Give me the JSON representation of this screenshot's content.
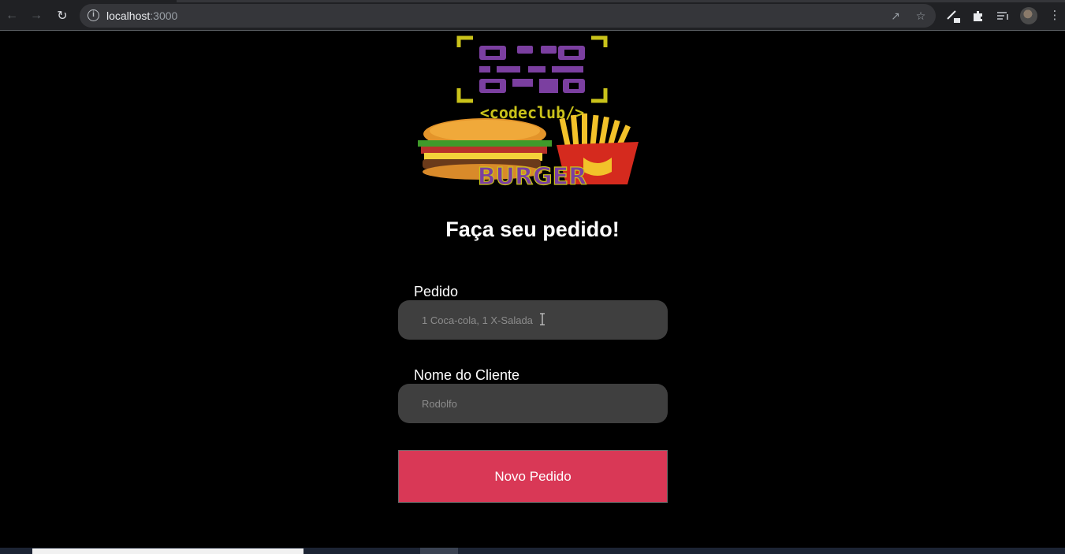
{
  "browser": {
    "url_host": "localhost",
    "url_port": ":3000",
    "icons": [
      "back-arrow-icon",
      "forward-arrow-icon",
      "reload-icon",
      "info-icon",
      "share-icon",
      "star-icon",
      "edit-icon",
      "extensions-icon",
      "reading-list-icon",
      "profile-avatar",
      "more-icon"
    ]
  },
  "page": {
    "logo_text": "<codeclub/>",
    "logo_sub": "BURGER",
    "heading": "Faça seu pedido!",
    "order_label": "Pedido",
    "order_placeholder": "1 Coca-cola, 1 X-Salada",
    "client_label": "Nome do Cliente",
    "client_placeholder": "Rodolfo",
    "submit_label": "Novo Pedido"
  },
  "colors": {
    "background": "#000000",
    "input_bg": "#3f3f3f",
    "button_bg": "#d93856",
    "logo_purple": "#7b3fa0",
    "logo_yellow": "#c9c21a"
  }
}
